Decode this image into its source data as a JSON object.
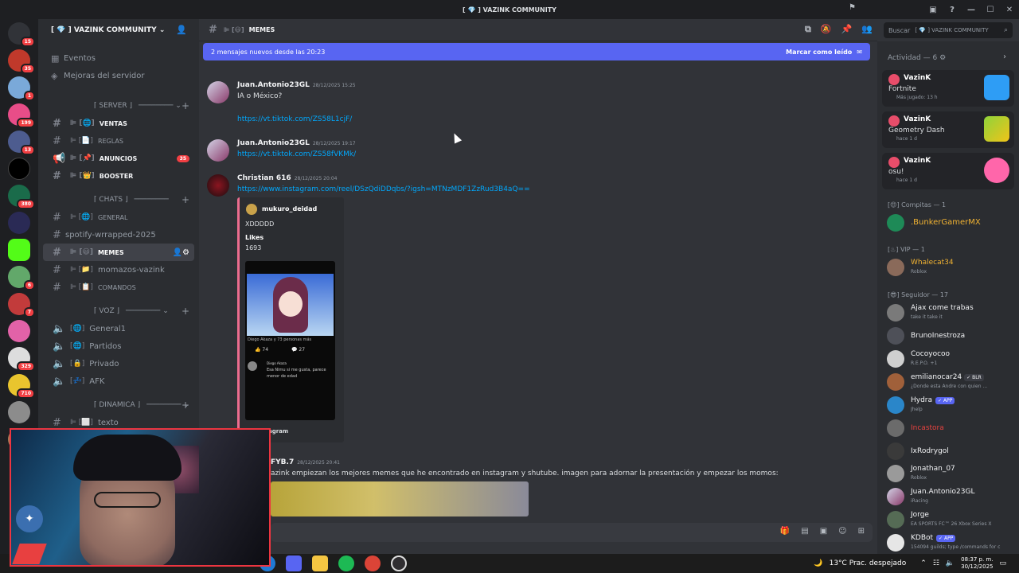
{
  "window": {
    "title": "[ 💎 ] VAZINK COMMUNITY"
  },
  "guild_badges": [
    "15",
    "35",
    "1",
    "199",
    "13",
    "380",
    "6",
    "7",
    "329",
    "710"
  ],
  "server": {
    "name": "[ 💎 ] VAZINK COMMUNITY ⌄",
    "events": "Eventos",
    "boosts": "Mejoras del servidor"
  },
  "categories": {
    "server": "⌈ SERVER ⌋",
    "chats": "⌈ CHATS ⌋",
    "voz": "⌈ VOZ ⌋",
    "dinamica": "⌈ DINAMICA ⌋"
  },
  "channels": {
    "ventas": "VENTAS",
    "reglas": "REGLAS",
    "anuncios": "ANUNCIOS",
    "anuncios_count": "35",
    "booster": "BOOSTER",
    "general": "GENERAL",
    "spotify": "spotify-wrrapped-2025",
    "memes": "MEMES",
    "momazos": "momazos-vazink",
    "comandos": "COMANDOS",
    "general1": "General1",
    "partidos": "Partidos",
    "privado": "Privado",
    "afk": "AFK",
    "texto": "texto"
  },
  "header": {
    "channel": "MEMES",
    "search_placeholder": "Buscar",
    "search_scope": "[ 💎 ] VAZINK COMMUNITY"
  },
  "newbar": {
    "text": "2 mensajes nuevos desde las 20:23",
    "action": "Marcar como leído"
  },
  "messages": [
    {
      "author": "Juan.Antonio23GL",
      "time": "28/12/2025 15:25",
      "text": "IA o México?",
      "link": "https://vt.tiktok.com/ZS58L1cjF/"
    },
    {
      "author": "Juan.Antonio23GL",
      "time": "28/12/2025 19:17",
      "link": "https://vt.tiktok.com/ZS58fVKMk/"
    },
    {
      "author": "Christian 616",
      "time": "28/12/2025 20:04",
      "link": "https://www.instagram.com/reel/DSzQdiDDqbs/?igsh=MTNzMDF1ZzRud3B4aQ=="
    },
    {
      "author": "FYB.7",
      "time": "28/12/2025 20:41",
      "text": "azink empiezan los mejores memes que he encontrado en instagram y shutube. imagen para adornar la presentación y empezar los momos:"
    }
  ],
  "embed": {
    "author": "mukuro_deidad",
    "text": "XDDDDD",
    "likes_label": "Likes",
    "likes": "1693",
    "overlay": "Diego Akaza y 73 personas más",
    "likes_count": "74",
    "comments_count": "27",
    "comment_author": "Diego Akaza",
    "comment_text": "Esa Nimu si me gusta, parece menor de edad",
    "footer": "agram"
  },
  "members": {
    "activity_header": "Actividad — 6",
    "activities": [
      {
        "name": "VazinK",
        "game": "Fortnite",
        "time": "Más jugado: 13 h"
      },
      {
        "name": "VazinK",
        "game": "Geometry Dash",
        "time": "hace 1 d"
      },
      {
        "name": "VazinK",
        "game": "osu!",
        "time": "hace 1 d"
      }
    ],
    "groups": {
      "compitas": "Compitas — 1",
      "vip": "VIP — 1",
      "seguidor": "Seguidor — 17"
    },
    "list": [
      {
        "name": ".BunkerGamerMX",
        "status": ""
      },
      {
        "name": "Whalecat34",
        "status": "Roblox"
      },
      {
        "name": "Ajax come trabas",
        "status": "take it take it"
      },
      {
        "name": "BrunoInestroza",
        "status": ""
      },
      {
        "name": "Cocoyocoo",
        "status": "R.E.P.O. +1"
      },
      {
        "name": "emilianocar24",
        "status": "¿Donde esta Andre con quien ..."
      },
      {
        "name": "Hydra",
        "status": "Jhelp",
        "app": "✓ APP"
      },
      {
        "name": "Incastora",
        "status": ""
      },
      {
        "name": "IxRodrygol",
        "status": ""
      },
      {
        "name": "Jonathan_07",
        "status": "Roblox"
      },
      {
        "name": "Juan.Antonio23GL",
        "status": "iRacing"
      },
      {
        "name": "Jorge",
        "status": "EA SPORTS FC™ 26 Xbox Series X"
      },
      {
        "name": "KDBot",
        "status": "154094 guilds; type /commands for c",
        "app": "✓ APP"
      }
    ]
  },
  "taskbar": {
    "weather": "13°C  Prac. despejado",
    "time": "08:37 p. m.",
    "date": "30/12/2025"
  },
  "colors": {
    "accent": "#5865f2",
    "link": "#00a8fc",
    "alert": "#f23f43",
    "webcam_border": "#ec3540"
  }
}
